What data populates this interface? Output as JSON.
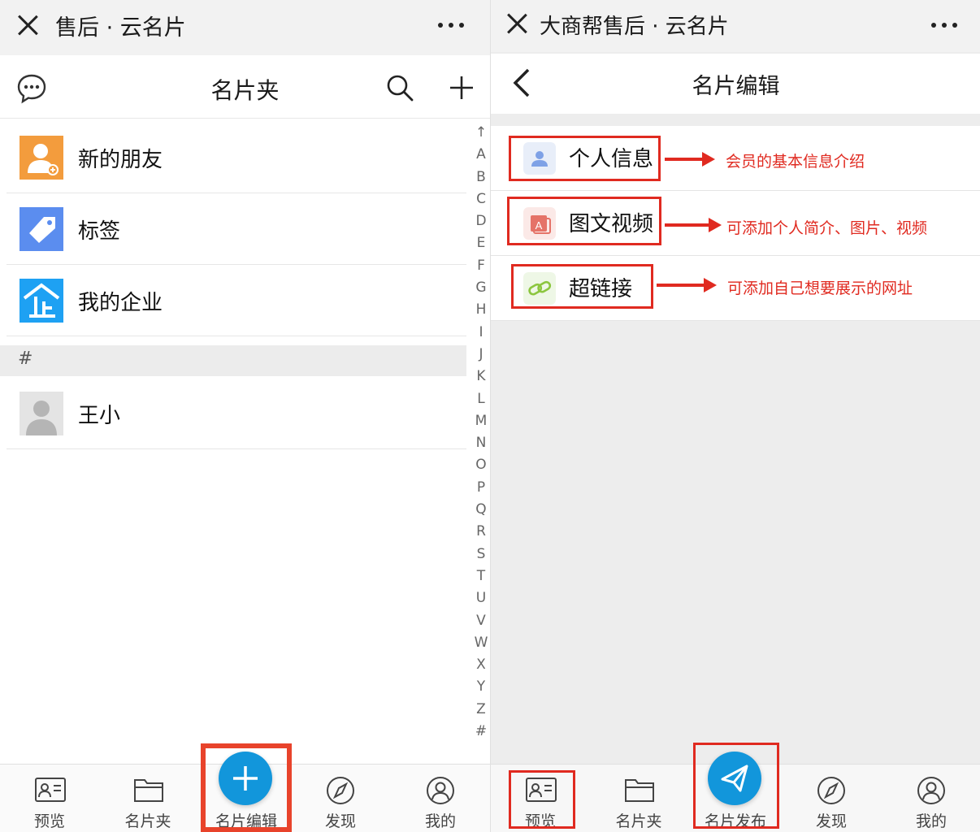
{
  "left": {
    "titlebar": {
      "title": "售后 · 云名片"
    },
    "header": {
      "title": "名片夹"
    },
    "contacts": [
      {
        "label": "新的朋友",
        "icon": "person-add-icon",
        "color": "#f39c3d"
      },
      {
        "label": "标签",
        "icon": "tag-icon",
        "color": "#5b8def"
      },
      {
        "label": "我的企业",
        "icon": "enterprise-icon",
        "color": "#1ea1f3"
      }
    ],
    "section": "#",
    "person": {
      "label": "王小"
    },
    "index_letters": [
      "↑",
      "A",
      "B",
      "C",
      "D",
      "E",
      "F",
      "G",
      "H",
      "I",
      "J",
      "K",
      "L",
      "M",
      "N",
      "O",
      "P",
      "Q",
      "R",
      "S",
      "T",
      "U",
      "V",
      "W",
      "X",
      "Y",
      "Z",
      "#"
    ],
    "tabs": {
      "preview": "预览",
      "cardholder": "名片夹",
      "edit": "名片编辑",
      "discover": "发现",
      "mine": "我的"
    }
  },
  "right": {
    "titlebar": {
      "title": "大商帮售后 · 云名片"
    },
    "header": {
      "title": "名片编辑"
    },
    "menu": [
      {
        "label": "个人信息",
        "annotation": "会员的基本信息介绍"
      },
      {
        "label": "图文视频",
        "annotation": "可添加个人简介、图片、视频"
      },
      {
        "label": "超链接",
        "annotation": "可添加自己想要展示的网址"
      }
    ],
    "tabs": {
      "preview": "预览",
      "cardholder": "名片夹",
      "publish": "名片发布",
      "discover": "发现",
      "mine": "我的"
    }
  },
  "colors": {
    "accent_blue": "#1296db",
    "annotation_red": "#e02a20"
  }
}
